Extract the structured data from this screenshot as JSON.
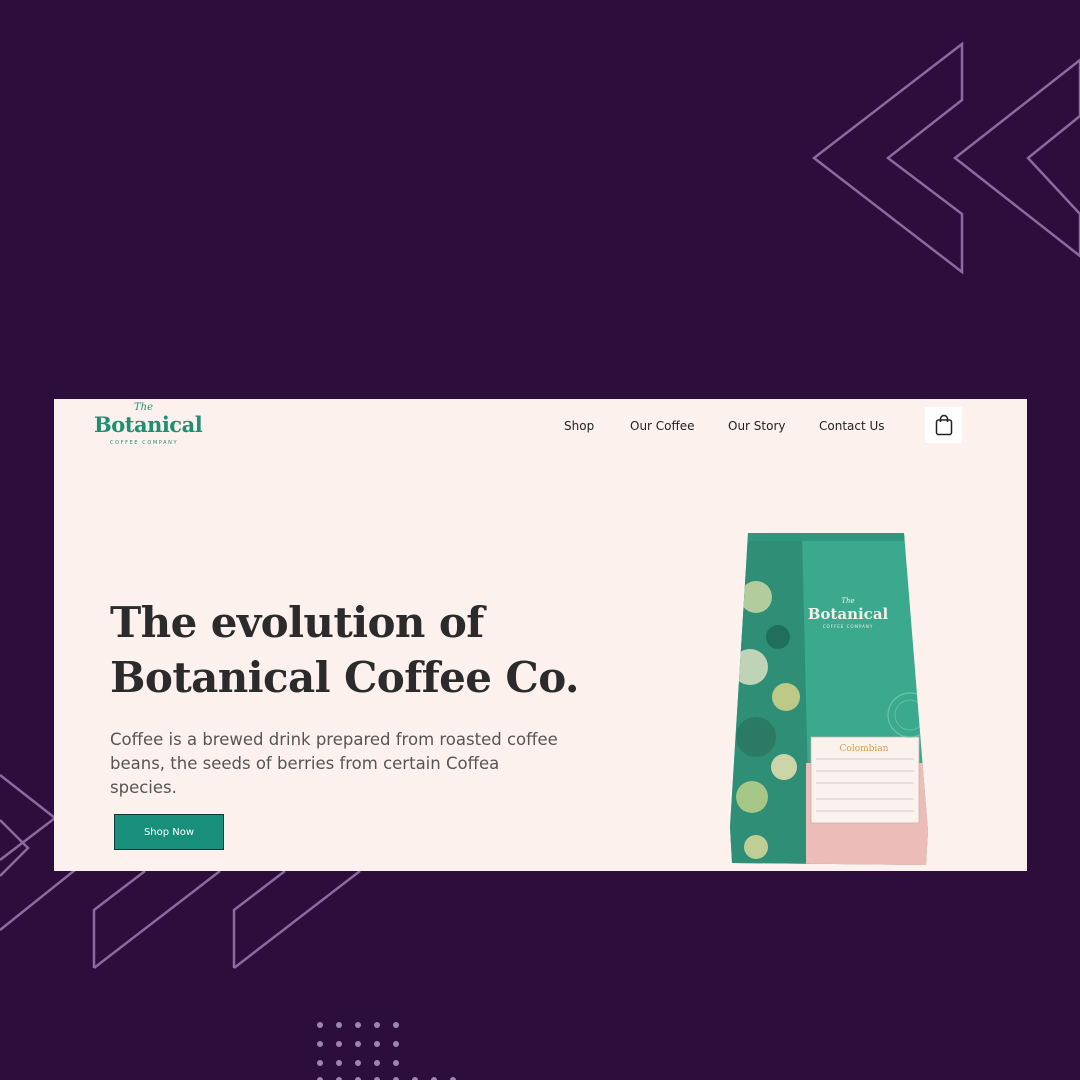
{
  "brand": {
    "the": "The",
    "name": "Botanical",
    "tagline": "COFFEE COMPANY"
  },
  "nav": {
    "items": [
      {
        "label": "Shop"
      },
      {
        "label": "Our Coffee"
      },
      {
        "label": "Our Story"
      },
      {
        "label": "Contact Us"
      }
    ],
    "cart_icon": "shopping-bag-icon"
  },
  "hero": {
    "title_line1": "The evolution of",
    "title_line2": "Botanical Coffee Co.",
    "description": "Coffee is a brewed drink prepared from roasted coffee beans, the seeds of berries from certain Coffea species.",
    "cta_label": "Shop Now"
  },
  "product": {
    "bag_the": "The",
    "bag_brand": "Botanical",
    "bag_tagline": "COFFEE COMPANY",
    "bag_origin": "Colombian"
  },
  "colors": {
    "background": "#2d0d3c",
    "frame": "#fdf1ed",
    "brand_green": "#1f8f72",
    "button": "#178f7a",
    "bag_green": "#3aa98d",
    "bag_pink": "#ecbcb8",
    "decor_lines": "#8b6aa0"
  }
}
